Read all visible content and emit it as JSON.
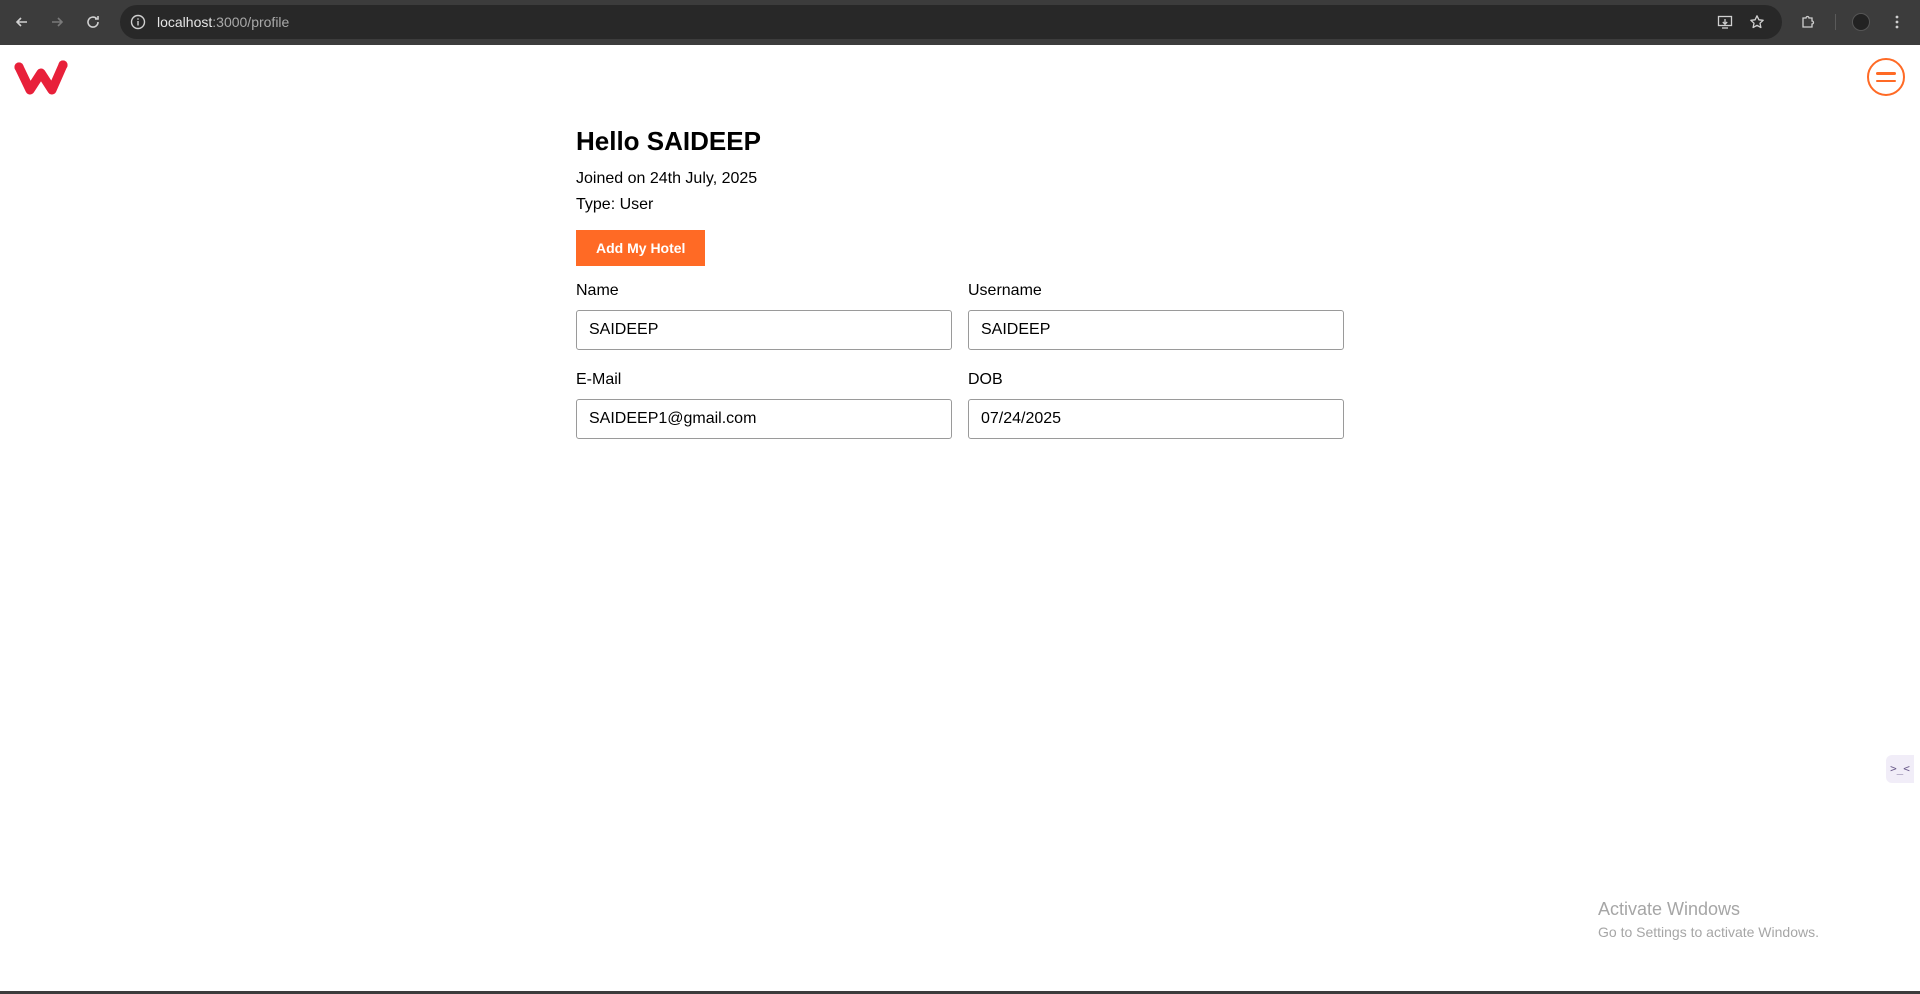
{
  "browser": {
    "url_host": "localhost",
    "url_path": ":3000/profile"
  },
  "header": {
    "logo_icon": "brand-w-logo",
    "menu_icon": "hamburger-menu-icon"
  },
  "profile": {
    "greeting": "Hello SAIDEEP",
    "joined": "Joined on 24th July, 2025",
    "type": "Type: User",
    "add_hotel_label": "Add My Hotel",
    "fields": {
      "name": {
        "label": "Name",
        "value": "SAIDEEP"
      },
      "username": {
        "label": "Username",
        "value": "SAIDEEP"
      },
      "email": {
        "label": "E-Mail",
        "value": "SAIDEEP1@gmail.com"
      },
      "dob": {
        "label": "DOB",
        "value": "07/24/2025"
      }
    }
  },
  "side_widget": {
    "glyph": ">_<"
  },
  "watermark": {
    "title": "Activate Windows",
    "subtitle": "Go to Settings to activate Windows."
  },
  "colors": {
    "accent": "#ff6a25",
    "logo": "#e8203a"
  }
}
